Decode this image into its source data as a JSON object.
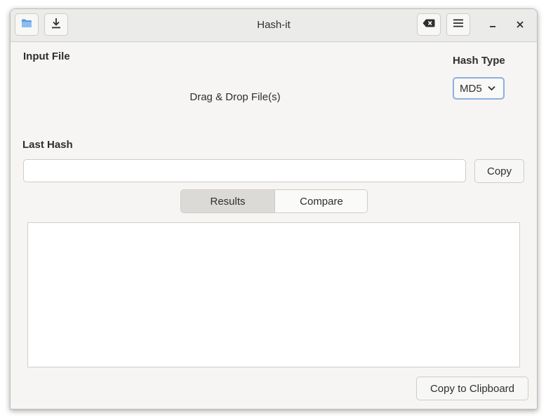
{
  "window": {
    "title": "Hash-it"
  },
  "headerbar": {
    "icons": {
      "open": "folder-icon",
      "save": "download-icon",
      "clear": "backspace-clear-icon",
      "menu": "hamburger-menu-icon",
      "minimize": "minimize-icon",
      "close": "close-icon"
    }
  },
  "input_file": {
    "label": "Input File",
    "drop_text": "Drag & Drop File(s)"
  },
  "hash_type": {
    "label": "Hash Type",
    "selected": "MD5"
  },
  "last_hash": {
    "label": "Last Hash",
    "value": "",
    "copy_label": "Copy"
  },
  "tabs": [
    {
      "label": "Results",
      "active": true
    },
    {
      "label": "Compare",
      "active": false
    }
  ],
  "footer": {
    "copy_clipboard_label": "Copy to Clipboard"
  },
  "colors": {
    "accent_folder": "#5b9ae0",
    "dropdown_focus": "#8eb0e0",
    "window_bg": "#f6f5f4"
  }
}
